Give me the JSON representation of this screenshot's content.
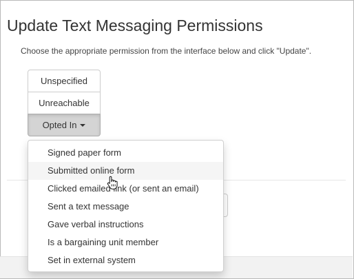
{
  "page": {
    "title": "Update Text Messaging Permissions",
    "instructions": "Choose the appropriate permission from the interface below and click \"Update\"."
  },
  "permission_buttons": [
    {
      "label": "Unspecified",
      "active": false
    },
    {
      "label": "Unreachable",
      "active": false
    },
    {
      "label": "Opted In",
      "active": true,
      "icon": "caret-down-icon"
    }
  ],
  "dropdown": {
    "items": [
      {
        "label": "Signed paper form",
        "hover": false
      },
      {
        "label": "Submitted online form",
        "hover": true
      },
      {
        "label": "Clicked emailed link (or sent an email)",
        "hover": false
      },
      {
        "label": "Sent a text message",
        "hover": false
      },
      {
        "label": "Gave verbal instructions",
        "hover": false
      },
      {
        "label": "Is a bargaining unit member",
        "hover": false
      },
      {
        "label": "Set in external system",
        "hover": false
      }
    ]
  },
  "cursor": {
    "icon": "hand-pointer-icon"
  },
  "colors": {
    "active_button": "#d4d4d4",
    "hover_item": "#f5f5f5",
    "text": "#333333"
  }
}
